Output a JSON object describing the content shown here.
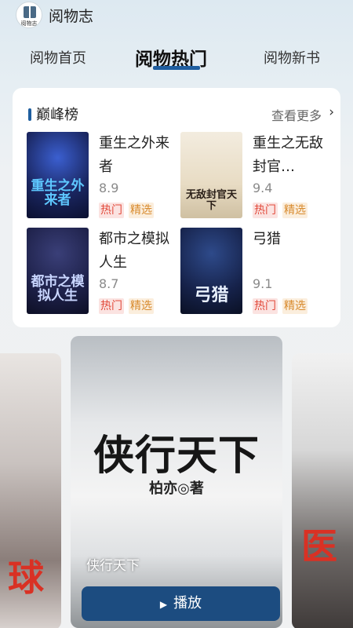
{
  "app": {
    "title": "阅物志",
    "logo_text": "阅物志"
  },
  "tabs": [
    {
      "label": "阅物首页",
      "active": false
    },
    {
      "label": "阅物热门",
      "active": true
    },
    {
      "label": "阅物新书",
      "active": false
    }
  ],
  "ranking": {
    "title": "巅峰榜",
    "more_label": "查看更多",
    "books": [
      {
        "name": "重生之外来者",
        "score": "8.9",
        "tags": [
          "热门",
          "精选"
        ],
        "cover_text": "重生之外来者"
      },
      {
        "name": "重生之无敌封官…",
        "score": "9.4",
        "tags": [
          "热门",
          "精选"
        ],
        "cover_text": "无敌封官天下"
      },
      {
        "name": "都市之模拟人生",
        "score": "8.7",
        "tags": [
          "热门",
          "精选"
        ],
        "cover_text": "都市之模拟人生"
      },
      {
        "name": "弓猎",
        "score": "9.1",
        "tags": [
          "热门",
          "精选"
        ],
        "cover_text": "弓猎"
      }
    ]
  },
  "featured": {
    "cover_title": "侠行天下",
    "cover_author": "柏亦◎著",
    "name": "侠行天下",
    "play_label": "播放",
    "left_cover_text": "球",
    "right_cover_text": "医"
  },
  "colors": {
    "accent": "#1f5e9f",
    "play_button": "#1c4c80",
    "hot_tag": "#e24b3c",
    "pick_tag": "#d88a2d"
  }
}
